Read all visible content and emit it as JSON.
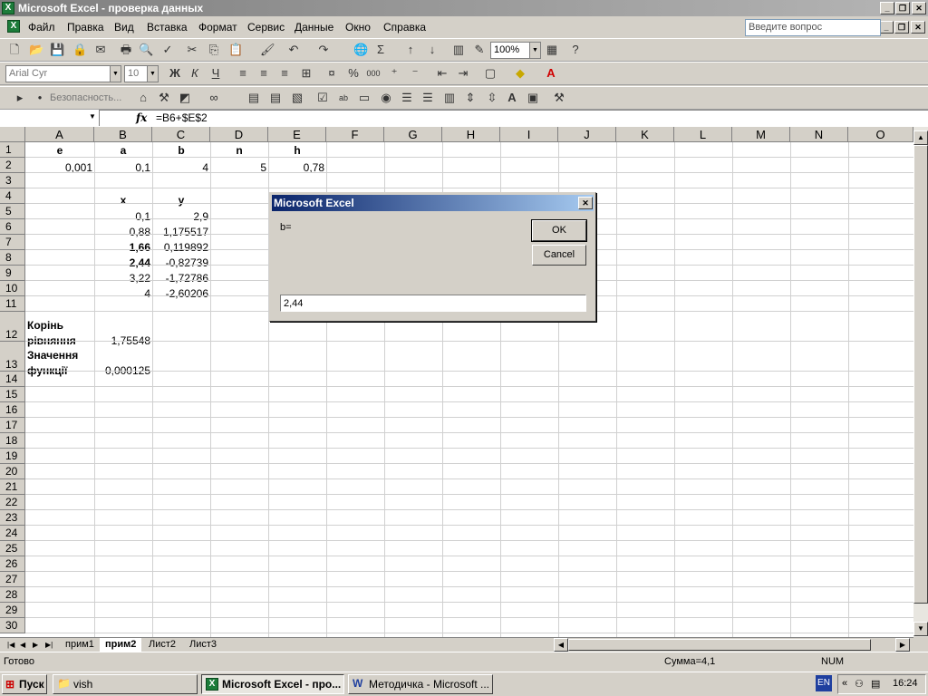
{
  "window": {
    "title": "Microsoft Excel - проверка данных"
  },
  "menu": [
    "Файл",
    "Правка",
    "Вид",
    "Вставка",
    "Формат",
    "Сервис",
    "Данные",
    "Окно",
    "Справка"
  ],
  "ask": {
    "placeholder": "Введите вопрос"
  },
  "toolbar": {
    "zoom": "100%",
    "font": "Arial Cyr",
    "size": "10",
    "security": "Безопасность..."
  },
  "formula": {
    "namebox": "",
    "fx": "fx",
    "value": "=B6+$E$2"
  },
  "columns": [
    "A",
    "B",
    "C",
    "D",
    "E",
    "F",
    "G",
    "H",
    "I",
    "J",
    "K",
    "L",
    "M",
    "N",
    "O"
  ],
  "rows": [
    "1",
    "2",
    "3",
    "4",
    "5",
    "6",
    "7",
    "8",
    "9",
    "10",
    "11",
    "12",
    "13",
    "14",
    "15",
    "16",
    "17",
    "18",
    "19",
    "20",
    "21",
    "22",
    "23",
    "24",
    "25",
    "26",
    "27",
    "28",
    "29",
    "30"
  ],
  "cells": {
    "A1": "e",
    "B1": "a",
    "C1": "b",
    "D1": "n",
    "E1": "h",
    "A2": "0,001",
    "B2": "0,1",
    "C2": "4",
    "D2": "5",
    "E2": "0,78",
    "B4": "x",
    "C4": "y",
    "B5": "0,1",
    "C5": "2,9",
    "B6": "0,88",
    "C6": "1,175517",
    "B7": "1,66",
    "C7": "0,119892",
    "B8": "2,44",
    "C8": "-0,82739",
    "B9": "3,22",
    "C9": "-1,72786",
    "B10": "4",
    "C10": "-2,60206",
    "A12a": "Корінь",
    "A12b": "рівняння",
    "B12": "1,75548",
    "A13a": "Значення",
    "A13b": "функції",
    "B13": "0,000125"
  },
  "sheets": [
    "прим1",
    "прим2",
    "Лист2",
    "Лист3"
  ],
  "status": {
    "ready": "Готово",
    "sum": "Сумма=4,1",
    "num": "NUM"
  },
  "taskbar": {
    "start": "Пуск",
    "tasks": [
      "vish",
      "Microsoft Excel - про...",
      "Методичка - Microsoft ..."
    ],
    "lang": "EN",
    "time": "16:24"
  },
  "dialog": {
    "title": "Microsoft Excel",
    "prompt": "b=",
    "ok": "OK",
    "cancel": "Cancel",
    "input": "2,44"
  }
}
